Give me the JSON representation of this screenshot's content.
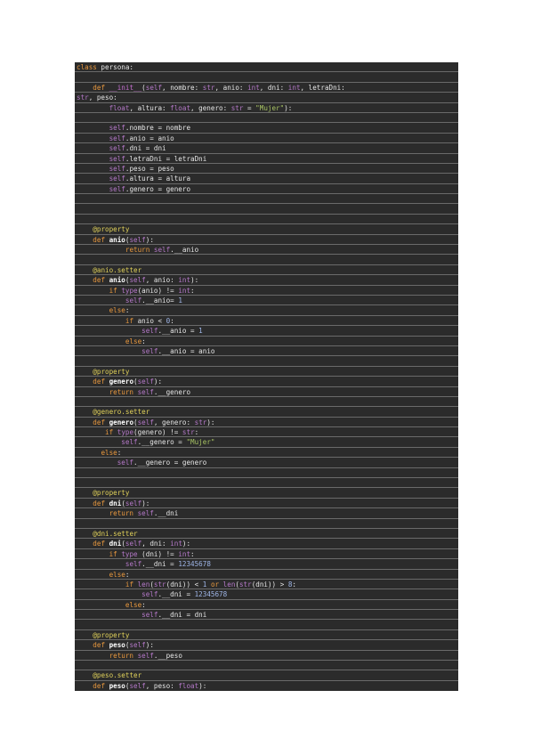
{
  "document": {
    "language": "python",
    "lines": [
      [
        [
          "kw",
          "class"
        ],
        [
          "pl",
          " persona:"
        ]
      ],
      [],
      [
        [
          "pl",
          "    "
        ],
        [
          "def",
          "def"
        ],
        [
          "pl",
          " "
        ],
        [
          "dun",
          "__init__"
        ],
        [
          "pl",
          "("
        ],
        [
          "self",
          "self"
        ],
        [
          "pl",
          ", nombre: "
        ],
        [
          "type",
          "str"
        ],
        [
          "pl",
          ", anio: "
        ],
        [
          "type",
          "int"
        ],
        [
          "pl",
          ", dni: "
        ],
        [
          "type",
          "int"
        ],
        [
          "pl",
          ", letraDni:"
        ]
      ],
      [
        [
          "type",
          "str"
        ],
        [
          "pl",
          ", peso:"
        ]
      ],
      [
        [
          "pl",
          "        "
        ],
        [
          "type",
          "float"
        ],
        [
          "pl",
          ", altura: "
        ],
        [
          "type",
          "float"
        ],
        [
          "pl",
          ", genero: "
        ],
        [
          "type",
          "str"
        ],
        [
          "pl",
          " = "
        ],
        [
          "str",
          "\"Mujer\""
        ],
        [
          "pl",
          "):"
        ]
      ],
      [],
      [
        [
          "pl",
          "        "
        ],
        [
          "self",
          "self"
        ],
        [
          "pl",
          ".nombre = nombre"
        ]
      ],
      [
        [
          "pl",
          "        "
        ],
        [
          "self",
          "self"
        ],
        [
          "pl",
          ".anio = anio"
        ]
      ],
      [
        [
          "pl",
          "        "
        ],
        [
          "self",
          "self"
        ],
        [
          "pl",
          ".dni = dni"
        ]
      ],
      [
        [
          "pl",
          "        "
        ],
        [
          "self",
          "self"
        ],
        [
          "pl",
          ".letraDni = letraDni"
        ]
      ],
      [
        [
          "pl",
          "        "
        ],
        [
          "self",
          "self"
        ],
        [
          "pl",
          ".peso = peso"
        ]
      ],
      [
        [
          "pl",
          "        "
        ],
        [
          "self",
          "self"
        ],
        [
          "pl",
          ".altura = altura"
        ]
      ],
      [
        [
          "pl",
          "        "
        ],
        [
          "self",
          "self"
        ],
        [
          "pl",
          ".genero = genero"
        ]
      ],
      [],
      [],
      [],
      [
        [
          "pl",
          "    "
        ],
        [
          "dec",
          "@property"
        ]
      ],
      [
        [
          "pl",
          "    "
        ],
        [
          "def",
          "def"
        ],
        [
          "pl",
          " "
        ],
        [
          "fn",
          "anio"
        ],
        [
          "pl",
          "("
        ],
        [
          "self",
          "self"
        ],
        [
          "pl",
          "):"
        ]
      ],
      [
        [
          "pl",
          "            "
        ],
        [
          "def",
          "return"
        ],
        [
          "pl",
          " "
        ],
        [
          "self",
          "self"
        ],
        [
          "pl",
          ".__anio"
        ]
      ],
      [],
      [
        [
          "pl",
          "    "
        ],
        [
          "dec",
          "@anio.setter"
        ]
      ],
      [
        [
          "pl",
          "    "
        ],
        [
          "def",
          "def"
        ],
        [
          "pl",
          " "
        ],
        [
          "fn",
          "anio"
        ],
        [
          "pl",
          "("
        ],
        [
          "self",
          "self"
        ],
        [
          "pl",
          ", anio: "
        ],
        [
          "type",
          "int"
        ],
        [
          "pl",
          "):"
        ]
      ],
      [
        [
          "pl",
          "        "
        ],
        [
          "def",
          "if"
        ],
        [
          "pl",
          " "
        ],
        [
          "type",
          "type"
        ],
        [
          "pl",
          "(anio) != "
        ],
        [
          "type",
          "int"
        ],
        [
          "pl",
          ":"
        ]
      ],
      [
        [
          "pl",
          "            "
        ],
        [
          "self",
          "self"
        ],
        [
          "pl",
          ".__anio= "
        ],
        [
          "num",
          "1"
        ]
      ],
      [
        [
          "pl",
          "        "
        ],
        [
          "def",
          "else"
        ],
        [
          "pl",
          ":"
        ]
      ],
      [
        [
          "pl",
          "            "
        ],
        [
          "def",
          "if"
        ],
        [
          "pl",
          " anio < "
        ],
        [
          "num",
          "0"
        ],
        [
          "pl",
          ":"
        ]
      ],
      [
        [
          "pl",
          "                "
        ],
        [
          "self",
          "self"
        ],
        [
          "pl",
          ".__anio = "
        ],
        [
          "num",
          "1"
        ]
      ],
      [
        [
          "pl",
          "            "
        ],
        [
          "def",
          "else"
        ],
        [
          "pl",
          ":"
        ]
      ],
      [
        [
          "pl",
          "                "
        ],
        [
          "self",
          "self"
        ],
        [
          "pl",
          ".__anio = anio"
        ]
      ],
      [],
      [
        [
          "pl",
          "    "
        ],
        [
          "dec",
          "@property"
        ]
      ],
      [
        [
          "pl",
          "    "
        ],
        [
          "def",
          "def"
        ],
        [
          "pl",
          " "
        ],
        [
          "fn",
          "genero"
        ],
        [
          "pl",
          "("
        ],
        [
          "self",
          "self"
        ],
        [
          "pl",
          "):"
        ]
      ],
      [
        [
          "pl",
          "        "
        ],
        [
          "def",
          "return"
        ],
        [
          "pl",
          " "
        ],
        [
          "self",
          "self"
        ],
        [
          "pl",
          ".__genero"
        ]
      ],
      [],
      [
        [
          "pl",
          "    "
        ],
        [
          "dec",
          "@genero.setter"
        ]
      ],
      [
        [
          "pl",
          "    "
        ],
        [
          "def",
          "def"
        ],
        [
          "pl",
          " "
        ],
        [
          "fn",
          "genero"
        ],
        [
          "pl",
          "("
        ],
        [
          "self",
          "self"
        ],
        [
          "pl",
          ", genero: "
        ],
        [
          "type",
          "str"
        ],
        [
          "pl",
          "):"
        ]
      ],
      [
        [
          "pl",
          "       "
        ],
        [
          "def",
          "if"
        ],
        [
          "pl",
          " "
        ],
        [
          "type",
          "type"
        ],
        [
          "pl",
          "(genero) != "
        ],
        [
          "type",
          "str"
        ],
        [
          "pl",
          ":"
        ]
      ],
      [
        [
          "pl",
          "           "
        ],
        [
          "self",
          "self"
        ],
        [
          "pl",
          ".__genero = "
        ],
        [
          "str",
          "\"Mujer\""
        ]
      ],
      [
        [
          "pl",
          "      "
        ],
        [
          "def",
          "else"
        ],
        [
          "pl",
          ":"
        ]
      ],
      [
        [
          "pl",
          "          "
        ],
        [
          "self",
          "self"
        ],
        [
          "pl",
          ".__genero = genero"
        ]
      ],
      [],
      [],
      [
        [
          "pl",
          "    "
        ],
        [
          "dec",
          "@property"
        ]
      ],
      [
        [
          "pl",
          "    "
        ],
        [
          "def",
          "def"
        ],
        [
          "pl",
          " "
        ],
        [
          "fn",
          "dni"
        ],
        [
          "pl",
          "("
        ],
        [
          "self",
          "self"
        ],
        [
          "pl",
          "):"
        ]
      ],
      [
        [
          "pl",
          "        "
        ],
        [
          "def",
          "return"
        ],
        [
          "pl",
          " "
        ],
        [
          "self",
          "self"
        ],
        [
          "pl",
          ".__dni"
        ]
      ],
      [],
      [
        [
          "pl",
          "    "
        ],
        [
          "dec",
          "@dni.setter"
        ]
      ],
      [
        [
          "pl",
          "    "
        ],
        [
          "def",
          "def"
        ],
        [
          "pl",
          " "
        ],
        [
          "fn",
          "dni"
        ],
        [
          "pl",
          "("
        ],
        [
          "self",
          "self"
        ],
        [
          "pl",
          ", dni: "
        ],
        [
          "type",
          "int"
        ],
        [
          "pl",
          "):"
        ]
      ],
      [
        [
          "pl",
          "        "
        ],
        [
          "def",
          "if"
        ],
        [
          "pl",
          " "
        ],
        [
          "type",
          "type"
        ],
        [
          "pl",
          " (dni) != "
        ],
        [
          "type",
          "int"
        ],
        [
          "pl",
          ":"
        ]
      ],
      [
        [
          "pl",
          "            "
        ],
        [
          "self",
          "self"
        ],
        [
          "pl",
          ".__dni = "
        ],
        [
          "num",
          "12345678"
        ]
      ],
      [
        [
          "pl",
          "        "
        ],
        [
          "def",
          "else"
        ],
        [
          "pl",
          ":"
        ]
      ],
      [
        [
          "pl",
          "            "
        ],
        [
          "def",
          "if"
        ],
        [
          "pl",
          " "
        ],
        [
          "type",
          "len"
        ],
        [
          "pl",
          "("
        ],
        [
          "type",
          "str"
        ],
        [
          "pl",
          "(dni)) < "
        ],
        [
          "num",
          "1"
        ],
        [
          "pl",
          " "
        ],
        [
          "def",
          "or"
        ],
        [
          "pl",
          " "
        ],
        [
          "type",
          "len"
        ],
        [
          "pl",
          "("
        ],
        [
          "type",
          "str"
        ],
        [
          "pl",
          "(dni)) > "
        ],
        [
          "num",
          "8"
        ],
        [
          "pl",
          ":"
        ]
      ],
      [
        [
          "pl",
          "                "
        ],
        [
          "self",
          "self"
        ],
        [
          "pl",
          ".__dni = "
        ],
        [
          "num",
          "12345678"
        ]
      ],
      [
        [
          "pl",
          "            "
        ],
        [
          "def",
          "else"
        ],
        [
          "pl",
          ":"
        ]
      ],
      [
        [
          "pl",
          "                "
        ],
        [
          "self",
          "self"
        ],
        [
          "pl",
          ".__dni = dni"
        ]
      ],
      [],
      [
        [
          "pl",
          "    "
        ],
        [
          "dec",
          "@property"
        ]
      ],
      [
        [
          "pl",
          "    "
        ],
        [
          "def",
          "def"
        ],
        [
          "pl",
          " "
        ],
        [
          "fn",
          "peso"
        ],
        [
          "pl",
          "("
        ],
        [
          "self",
          "self"
        ],
        [
          "pl",
          "):"
        ]
      ],
      [
        [
          "pl",
          "        "
        ],
        [
          "def",
          "return"
        ],
        [
          "pl",
          " "
        ],
        [
          "self",
          "self"
        ],
        [
          "pl",
          ".__peso"
        ]
      ],
      [],
      [
        [
          "pl",
          "    "
        ],
        [
          "dec",
          "@peso.setter"
        ]
      ],
      [
        [
          "pl",
          "    "
        ],
        [
          "def",
          "def"
        ],
        [
          "pl",
          " "
        ],
        [
          "fn",
          "peso"
        ],
        [
          "pl",
          "("
        ],
        [
          "self",
          "self"
        ],
        [
          "pl",
          ", peso: "
        ],
        [
          "type",
          "float"
        ],
        [
          "pl",
          "):"
        ]
      ]
    ]
  },
  "theme": {
    "background": "#2b2b2b",
    "page_background": "#ffffff",
    "keyword": "#e8983e",
    "decorator": "#e0d15a",
    "self": "#b478c8",
    "string": "#a8c463",
    "number": "#9fb6e8"
  }
}
